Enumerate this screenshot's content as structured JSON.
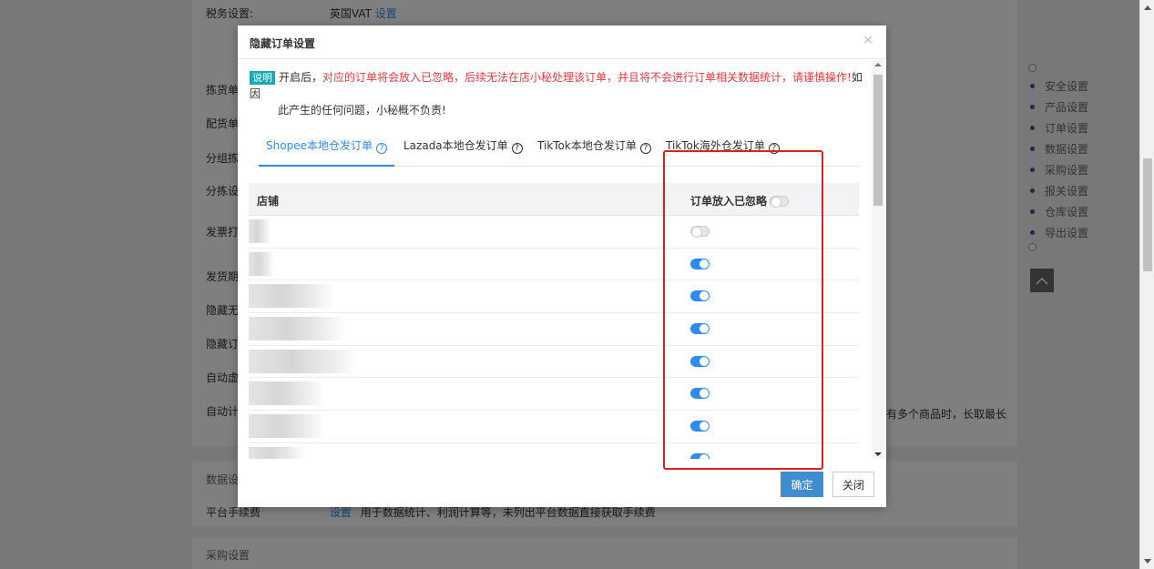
{
  "background": {
    "vat_label": "税务设置:",
    "vat_value": "英国VAT",
    "vat_link": "设置",
    "left_rows": [
      "拣货单",
      "配货单",
      "分组拣",
      "分拣设",
      "发票打",
      "发货期",
      "隐藏无",
      "隐藏订",
      "自动虚",
      "自动计"
    ],
    "right_text": "有多个商品时，长取最长",
    "section_data": "数据设置",
    "platform_fee_label": "平台手续费",
    "platform_fee_link": "设置",
    "platform_fee_desc": "用于数据统计、利润计算等，未列出平台数据直接获取手续费",
    "section_purchase": "采购设置"
  },
  "right_nav": {
    "items": [
      "安全设置",
      "产品设置",
      "订单设置",
      "数据设置",
      "采购设置",
      "报关设置",
      "仓库设置",
      "导出设置"
    ]
  },
  "modal": {
    "title": "隐藏订单设置",
    "close_symbol": "×",
    "notice_badge": "说明",
    "notice_prefix": "开启后，",
    "notice_warning": "对应的订单将会放入已忽略，后续无法在店小秘处理该订单，并且将不会进行订单相关数据统计，请谨慎操作!",
    "notice_suffix_line1": "如因",
    "notice_line2": "此产生的任何问题，小秘概不负责!",
    "tabs": [
      {
        "label": "Shopee本地仓发订单",
        "active": true
      },
      {
        "label": "Lazada本地仓发订单",
        "active": false
      },
      {
        "label": "TikTok本地仓发订单",
        "active": false
      },
      {
        "label": "TikTok海外仓发订单",
        "active": false
      }
    ],
    "help_symbol": "?",
    "table": {
      "col_shop": "店铺",
      "col_toggle": "订单放入已忽略",
      "header_toggle_on": false,
      "rows": [
        {
          "shop": "",
          "ignored": false
        },
        {
          "shop": "",
          "ignored": true
        },
        {
          "shop": "",
          "ignored": true
        },
        {
          "shop": "",
          "ignored": true
        },
        {
          "shop": "",
          "ignored": true
        },
        {
          "shop": "",
          "ignored": true
        },
        {
          "shop": "",
          "ignored": true
        },
        {
          "shop": "",
          "ignored": true
        },
        {
          "shop": "",
          "ignored": true
        }
      ]
    },
    "ok_label": "确定",
    "close_label": "关闭"
  },
  "colors": {
    "accent": "#2d8cf0",
    "warning_red": "#e4393c",
    "highlight_box": "#e0201a",
    "badge": "#19a8b3"
  }
}
